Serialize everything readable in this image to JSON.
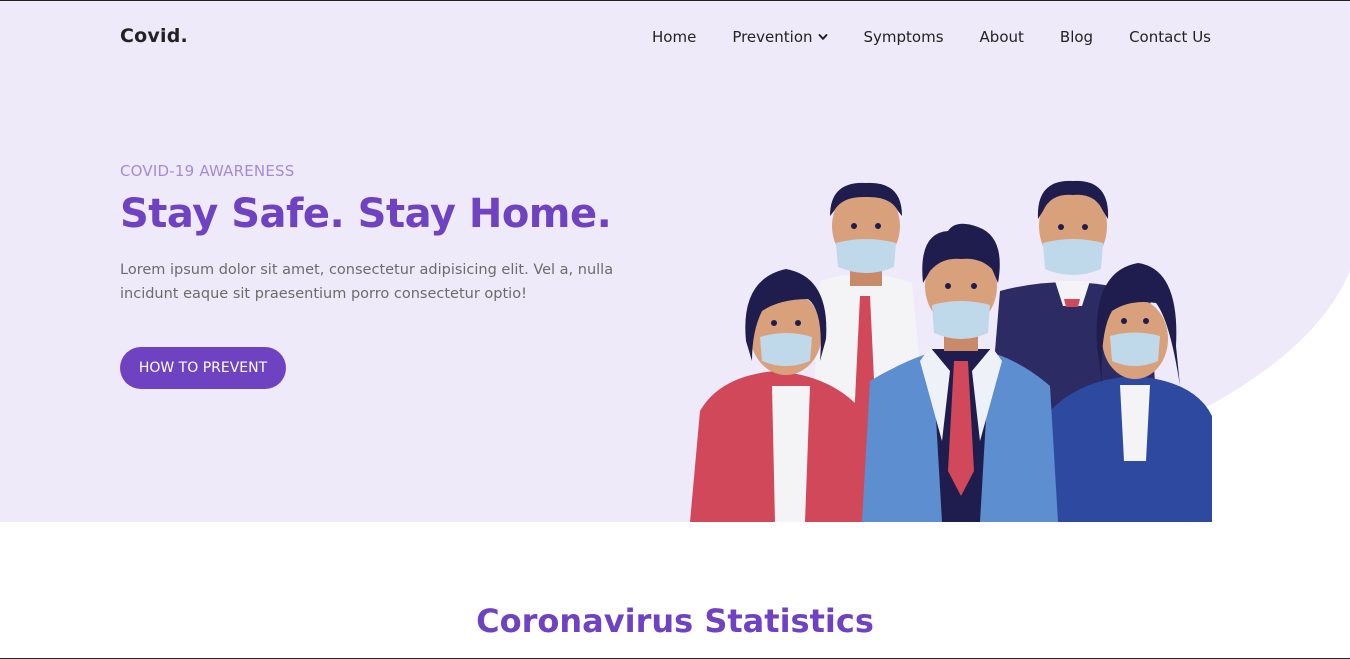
{
  "brand": "Covid.",
  "nav": [
    {
      "label": "Home"
    },
    {
      "label": "Prevention",
      "icon": "chevron-down-icon"
    },
    {
      "label": "Symptoms"
    },
    {
      "label": "About"
    },
    {
      "label": "Blog"
    },
    {
      "label": "Contact Us"
    }
  ],
  "hero": {
    "eyebrow": "COVID-19 AWARENESS",
    "headline": "Stay Safe. Stay Home.",
    "lead": "Lorem ipsum dolor sit amet, consectetur adipisicing elit. Vel a, nulla incidunt eaque sit praesentium porro consectetur optio!",
    "cta_label": "HOW TO PREVENT",
    "illustration": "people-wearing-masks-illustration"
  },
  "stats": {
    "title": "Coronavirus Statistics"
  },
  "colors": {
    "primary": "#6f42c1",
    "hero_background": "#efeaf9",
    "eyebrow": "#a58bd6",
    "body_text": "#6b6b6b"
  }
}
